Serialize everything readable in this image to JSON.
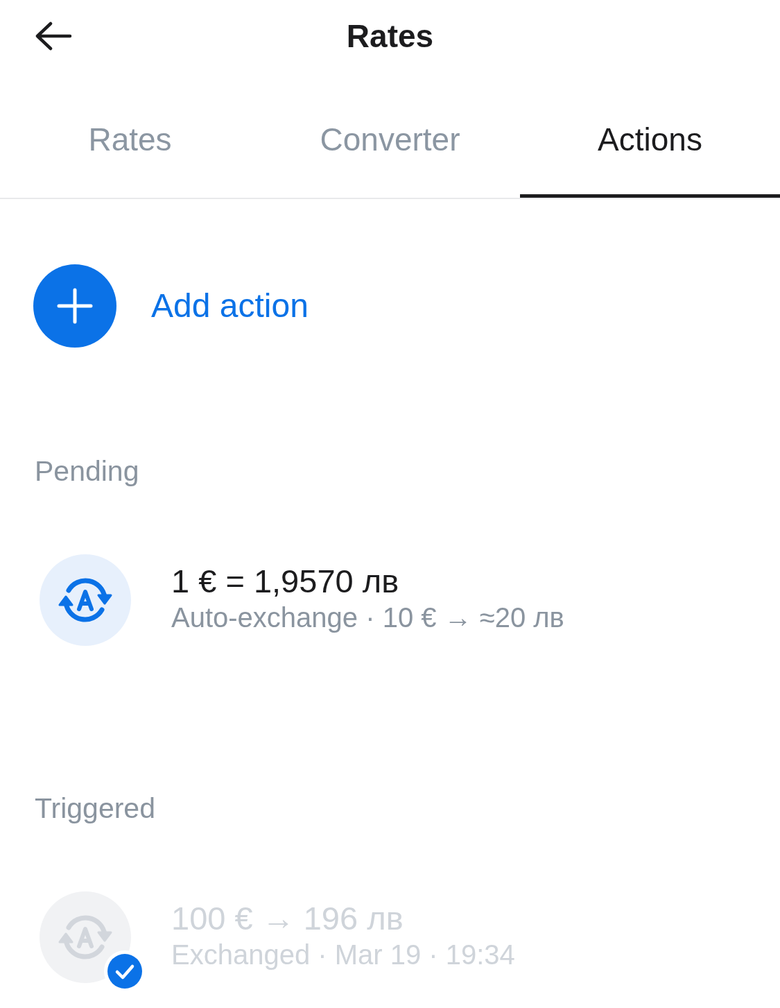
{
  "header": {
    "title": "Rates"
  },
  "tabs": [
    {
      "label": "Rates",
      "selected": false
    },
    {
      "label": "Converter",
      "selected": false
    },
    {
      "label": "Actions",
      "selected": true
    }
  ],
  "add_action": {
    "label": "Add action"
  },
  "sections": [
    {
      "title": "Pending",
      "items": [
        {
          "title": "1 € = 1,9570 лв",
          "subtitle": "Auto-exchange · 10 € → ≈20 лв",
          "done": false
        }
      ]
    },
    {
      "title": "Triggered",
      "items": [
        {
          "title": "100 € → 196 лв",
          "subtitle": "Exchanged · Mar 19 · 19:34",
          "done": true
        }
      ]
    }
  ]
}
